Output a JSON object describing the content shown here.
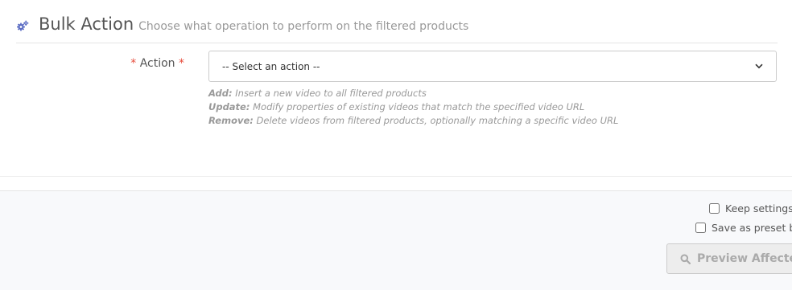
{
  "section": {
    "icon": "cogs-icon",
    "title": "Bulk Action",
    "subtitle": "Choose what operation to perform on the filtered products"
  },
  "form": {
    "action_label": "Action",
    "required_marker": "*",
    "action_select_value": "-- Select an action --",
    "help": [
      {
        "term": "Add:",
        "desc": "Insert a new video to all filtered products"
      },
      {
        "term": "Update:",
        "desc": "Modify properties of existing videos that match the specified video URL"
      },
      {
        "term": "Remove:",
        "desc": "Delete videos from filtered products, optionally matching a specific video URL"
      }
    ]
  },
  "footer": {
    "keep_settings_label": "Keep settings a",
    "save_preset_label": "Save as preset be",
    "preview_button_label": "Preview Affected",
    "preview_button_icon": "search-icon"
  },
  "colors": {
    "accent": "#5d6ec4",
    "required": "#e74c3c",
    "muted_text": "#999999",
    "footer_bg": "#f8f9fb"
  }
}
